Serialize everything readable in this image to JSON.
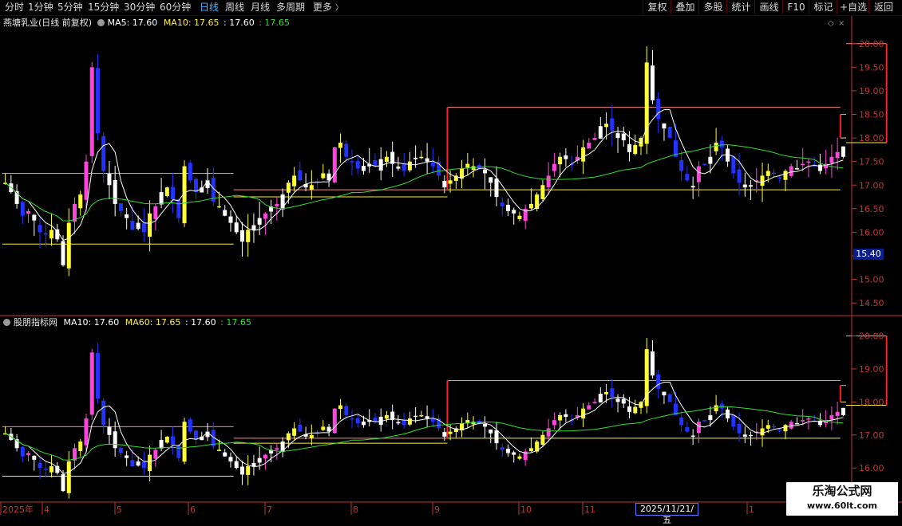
{
  "toolbar": {
    "periods": [
      {
        "label": "分时",
        "active": false
      },
      {
        "label": "1分钟",
        "active": false
      },
      {
        "label": "5分钟",
        "active": false
      },
      {
        "label": "15分钟",
        "active": false
      },
      {
        "label": "30分钟",
        "active": false
      },
      {
        "label": "60分钟",
        "active": false
      },
      {
        "label": "日线",
        "active": true
      },
      {
        "label": "周线",
        "active": false
      },
      {
        "label": "月线",
        "active": false
      },
      {
        "label": "多周期",
        "active": false
      },
      {
        "label": "更多",
        "active": false
      }
    ],
    "actions": [
      "复权",
      "叠加",
      "多股",
      "统计",
      "画线",
      "F10",
      "标记",
      "+自选",
      "返回"
    ]
  },
  "main_panel": {
    "stock_name": "燕塘乳业(日线 前复权)",
    "ma5_label": "MA5: 17.60",
    "ma10_label": "MA10: 17.65",
    "extra1": ": 17.60",
    "extra2": ": 17.65",
    "y_ticks": [
      "20.00",
      "19.50",
      "19.00",
      "18.50",
      "18.00",
      "17.50",
      "17.00",
      "16.50",
      "16.00",
      "15.50",
      "15.00",
      "14.50"
    ],
    "price_tag": "15.40"
  },
  "indicator_panel": {
    "title": "股朋指标网",
    "ma10_label": "MA10: 17.60",
    "ma60_label": "MA60: 17.65",
    "extra1": ": 17.60",
    "extra2": ": 17.65",
    "y_ticks": [
      "20.00",
      "19.00",
      "18.00",
      "17.00",
      "16.00"
    ]
  },
  "date_axis": {
    "labels": [
      "2025年",
      "4",
      "5",
      "6",
      "7",
      "8",
      "9",
      "10",
      "11",
      "1"
    ],
    "cursor_date": "2025/11/21/五"
  },
  "watermark": {
    "title": "乐淘公式网",
    "url": "www.60lt.com"
  },
  "colors": {
    "background": "#000000",
    "up_candle": "#ff44dd",
    "down_candle": "#2233ff",
    "yellow_candle": "#ffff33",
    "white_candle": "#ffffff",
    "ma_short": "#ffffff",
    "ma_long": "#33dd33",
    "axis": "#c0392b",
    "box_red": "#ff2222",
    "line_pink": "#ff8888",
    "line_yellow": "#ffee44"
  },
  "chart_data": {
    "type": "candlestick",
    "symbol_name": "燕塘乳业",
    "ylim_main": [
      14.3,
      20.3
    ],
    "ylim_indicator": [
      15.4,
      20.4
    ],
    "last_close": 17.6,
    "closes": [
      17.05,
      16.85,
      16.6,
      16.35,
      16.45,
      16.25,
      16.0,
      15.95,
      16.05,
      15.85,
      15.3,
      16.2,
      16.6,
      16.8,
      17.5,
      19.5,
      18.1,
      17.3,
      17.0,
      16.6,
      16.45,
      16.3,
      16.05,
      16.2,
      16.0,
      16.4,
      16.55,
      16.85,
      16.95,
      16.7,
      16.3,
      17.4,
      17.1,
      16.85,
      16.95,
      17.1,
      16.65,
      16.55,
      16.35,
      16.2,
      16.0,
      15.8,
      16.05,
      16.15,
      16.3,
      16.4,
      16.55,
      16.6,
      16.8,
      17.05,
      17.2,
      17.1,
      16.95,
      17.0,
      17.05,
      17.25,
      17.1,
      17.8,
      17.9,
      17.6,
      17.5,
      17.35,
      17.3,
      17.45,
      17.4,
      17.55,
      17.6,
      17.45,
      17.35,
      17.3,
      17.5,
      17.55,
      17.6,
      17.5,
      17.4,
      17.2,
      16.95,
      17.1,
      17.2,
      17.35,
      17.45,
      17.4,
      17.35,
      17.25,
      17.05,
      16.75,
      16.55,
      16.45,
      16.4,
      16.35,
      16.5,
      16.6,
      16.8,
      17.0,
      17.2,
      17.45,
      17.6,
      17.55,
      17.45,
      17.6,
      17.8,
      17.9,
      18.0,
      18.25,
      18.3,
      18.15,
      18.0,
      17.95,
      17.7,
      17.85,
      18.0,
      19.6,
      18.8,
      18.4,
      18.2,
      18.0,
      17.6,
      17.3,
      17.1,
      16.95,
      17.4,
      17.45,
      17.6,
      17.9,
      17.8,
      17.5,
      17.25,
      17.05,
      16.95,
      17.0,
      17.1,
      17.2,
      17.3,
      17.25,
      17.15,
      17.3,
      17.4,
      17.35,
      17.45,
      17.5,
      17.4,
      17.3,
      17.45,
      17.6,
      17.7,
      17.6
    ]
  }
}
